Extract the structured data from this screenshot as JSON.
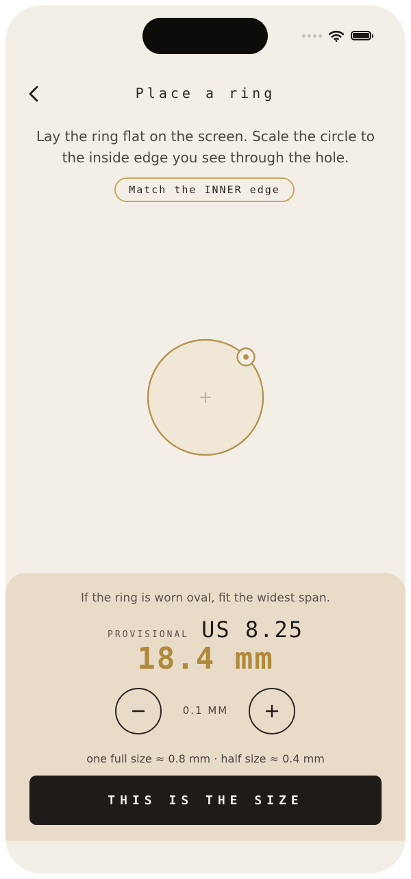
{
  "header": {
    "title": "Place a ring"
  },
  "instructions": "Lay the ring flat on the screen. Scale the circle to the inside edge you see through the hole.",
  "badge": "Match the INNER edge",
  "panel": {
    "hint": "If the ring is worn oval, fit the widest span.",
    "provisional_label": "PROVISIONAL",
    "us_size": "US 8.25",
    "mm_value": "18.4 mm",
    "step_label": "0.1 MM",
    "conversion": "one full size ≈ 0.8 mm · half size ≈ 0.4 mm",
    "cta": "THIS IS THE SIZE"
  },
  "icons": [
    "back-chevron-icon",
    "wifi-icon",
    "battery-icon",
    "minus-icon",
    "plus-icon",
    "crosshair-icon",
    "resize-handle-icon"
  ],
  "colors": {
    "background": "#f4efe6",
    "panel": "#e8dcc9",
    "accent": "#b08a3c",
    "ring": "#b39451",
    "dark": "#1e1b18"
  }
}
